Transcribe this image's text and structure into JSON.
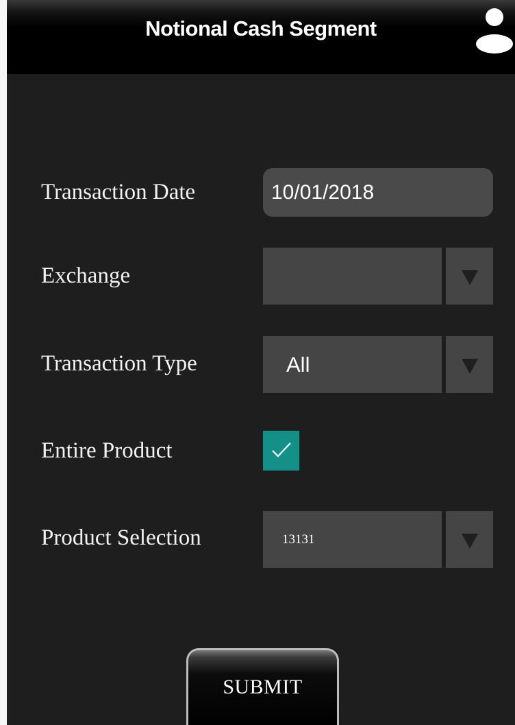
{
  "header": {
    "title": "Notional Cash Segment",
    "user_icon": "user-icon"
  },
  "form": {
    "transaction_date": {
      "label": "Transaction Date",
      "value": "10/01/2018"
    },
    "exchange": {
      "label": "Exchange",
      "value": ""
    },
    "transaction_type": {
      "label": "Transaction Type",
      "value": "All"
    },
    "entire_product": {
      "label": "Entire Product",
      "checked": true
    },
    "product_selection": {
      "label": "Product Selection",
      "value": "13131"
    }
  },
  "actions": {
    "submit_label": "SUBMIT"
  },
  "colors": {
    "background": "#1e1e1e",
    "header": "#000000",
    "field": "#454545",
    "checkbox": "#139189"
  }
}
